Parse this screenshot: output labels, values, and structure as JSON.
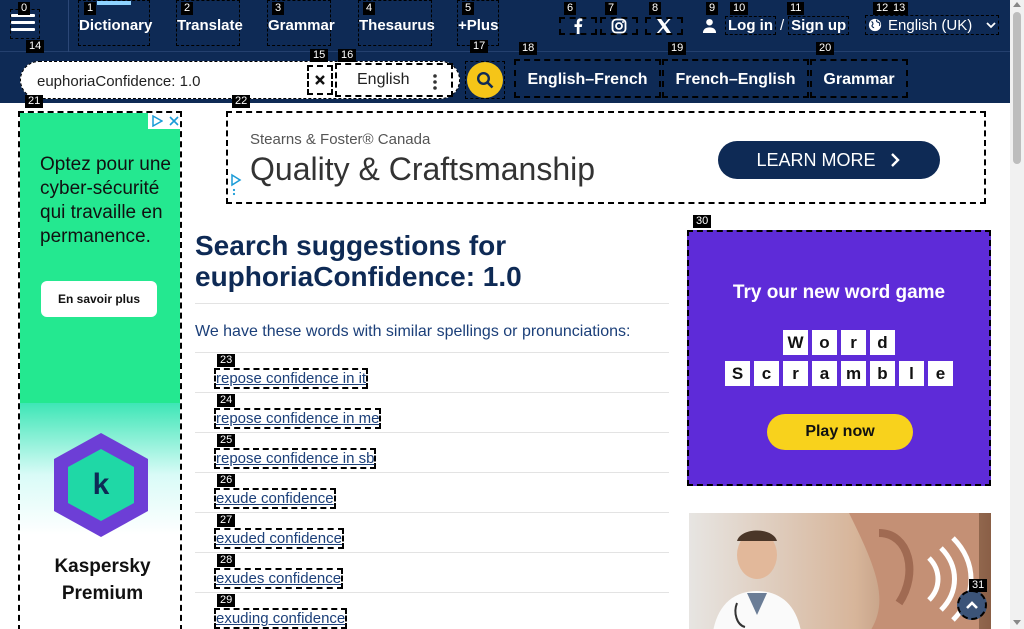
{
  "nav": {
    "links": [
      {
        "label": "Dictionary",
        "badge": "1"
      },
      {
        "label": "Translate",
        "badge": "2"
      },
      {
        "label": "Grammar",
        "badge": "3"
      },
      {
        "label": "Thesaurus",
        "badge": "4"
      },
      {
        "label": "+Plus",
        "badge": "5"
      }
    ],
    "menu_badge": "0",
    "social": [
      {
        "icon": "facebook-icon",
        "badge": "6"
      },
      {
        "icon": "instagram-icon",
        "badge": "7"
      },
      {
        "icon": "x-twitter-icon",
        "badge": "8"
      }
    ],
    "auth": {
      "login": "Log in",
      "separator": "/",
      "signup": "Sign up",
      "badge_user": "9",
      "badge_login": "10",
      "badge_signup": "11"
    },
    "language": {
      "label": "English (UK)",
      "badge_a": "12",
      "badge_b": "13"
    }
  },
  "search": {
    "value": "euphoriaConfidence: 1.0",
    "badge": "14",
    "clear_badge": "15",
    "language": "English",
    "language_badge": "16",
    "go_badge": "17",
    "dict_links": [
      {
        "label": "English–French",
        "badge": "18"
      },
      {
        "label": "French–English",
        "badge": "19"
      },
      {
        "label": "Grammar",
        "badge": "20"
      }
    ]
  },
  "left_ad": {
    "badge": "21",
    "text": "Optez pour une cyber-sécurité qui travaille en permanence.",
    "cta": "En savoir plus",
    "brand_line1": "Kaspersky",
    "brand_line2": "Premium"
  },
  "banner_ad": {
    "badge": "22",
    "sponsor": "Stearns & Foster® Canada",
    "headline": "Quality & Craftsmanship",
    "cta": "LEARN MORE"
  },
  "main": {
    "title_prefix": "Search suggestions for",
    "title_term": "euphoriaConfidence: 1.0",
    "intro": "We have these words with similar spellings or pronunciations:",
    "suggestions": [
      {
        "text": "repose confidence in it",
        "badge": "23"
      },
      {
        "text": "repose confidence in me",
        "badge": "24"
      },
      {
        "text": "repose confidence in sb",
        "badge": "25"
      },
      {
        "text": "exude confidence",
        "badge": "26"
      },
      {
        "text": "exuded confidence",
        "badge": "27"
      },
      {
        "text": "exudes confidence",
        "badge": "28"
      },
      {
        "text": "exuding confidence",
        "badge": "29"
      }
    ]
  },
  "right_ad": {
    "badge": "30",
    "headline": "Try our new word game",
    "tiles_row1": [
      "W",
      "o",
      "r",
      "d"
    ],
    "tiles_row2": [
      "S",
      "c",
      "r",
      "a",
      "m",
      "b",
      "l",
      "e"
    ],
    "cta": "Play now"
  },
  "scroll_top_badge": "31",
  "colors": {
    "navy": "#0e2a55",
    "accent": "#f5c518",
    "link": "#1b3f79",
    "ad_green": "#24e890",
    "ad_purple": "#5e2bd8"
  }
}
